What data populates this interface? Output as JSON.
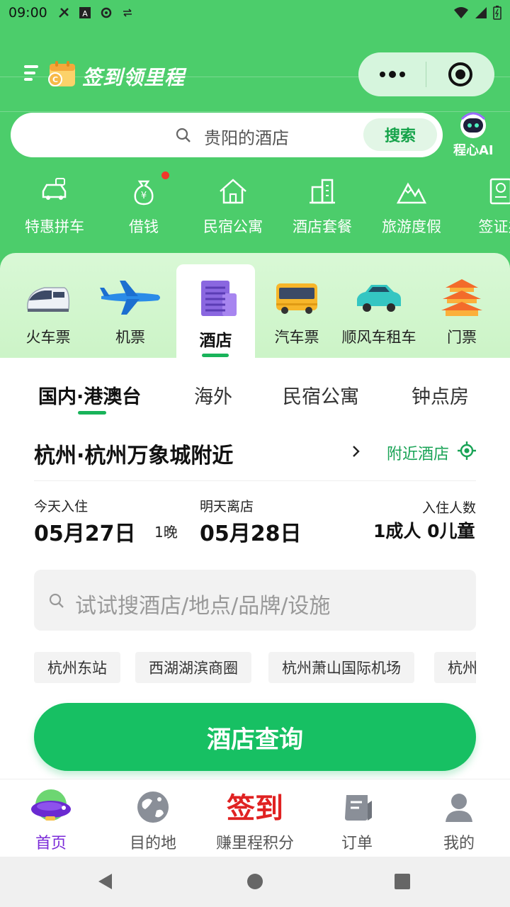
{
  "status_bar": {
    "time": "09:00"
  },
  "header": {
    "title": "签到领里程"
  },
  "search": {
    "placeholder": "贵阳的酒店",
    "button_label": "搜索"
  },
  "ai": {
    "label": "程心AI"
  },
  "quick_links": [
    {
      "label": "特惠拼车",
      "icon": "car-icon"
    },
    {
      "label": "借钱",
      "icon": "money-bag-icon"
    },
    {
      "label": "民宿公寓",
      "icon": "house-icon"
    },
    {
      "label": "酒店套餐",
      "icon": "building-icon"
    },
    {
      "label": "旅游度假",
      "icon": "mountain-icon"
    },
    {
      "label": "签证办",
      "icon": "passport-icon"
    }
  ],
  "categories": [
    {
      "label": "火车票",
      "icon": "train-icon"
    },
    {
      "label": "机票",
      "icon": "plane-icon"
    },
    {
      "label": "酒店",
      "icon": "hotel-icon",
      "active": true
    },
    {
      "label": "汽车票",
      "icon": "bus-icon"
    },
    {
      "label": "顺风车租车",
      "icon": "car-icon"
    },
    {
      "label": "门票",
      "icon": "temple-icon"
    }
  ],
  "region_tabs": [
    "国内·港澳台",
    "海外",
    "民宿公寓",
    "钟点房"
  ],
  "location": {
    "text": "杭州·杭州万象城附近",
    "nearby_label": "附近酒店"
  },
  "checkin": {
    "label": "今天入住",
    "date": "05月27日"
  },
  "nights": "1晚",
  "checkout": {
    "label": "明天离店",
    "date": "05月28日"
  },
  "guests": {
    "label": "入住人数",
    "value": "1成人 0儿童"
  },
  "hotel_search": {
    "placeholder": "试试搜酒店/地点/品牌/设施"
  },
  "chips": [
    "杭州东站",
    "西湖湖滨商圈",
    "杭州萧山国际机场",
    "杭州"
  ],
  "query_button": "酒店查询",
  "bottom_nav": [
    {
      "label": "首页",
      "icon": "blimp-icon",
      "active": true
    },
    {
      "label": "目的地",
      "icon": "globe-icon"
    },
    {
      "label": "赚里程积分",
      "icon": "signin-text",
      "big_text": "签到"
    },
    {
      "label": "订单",
      "icon": "order-icon"
    },
    {
      "label": "我的",
      "icon": "user-icon"
    }
  ],
  "colors": {
    "brand_green": "#4ccd6b",
    "accent_green": "#17c063",
    "active_purple": "#7b2bd8",
    "badge_red": "#f0372b"
  }
}
